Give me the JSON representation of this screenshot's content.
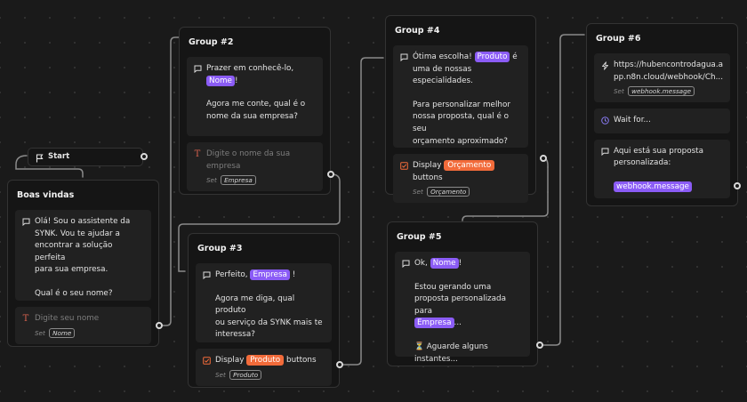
{
  "start": {
    "label": "Start"
  },
  "groups": {
    "boas_vindas": {
      "title": "Boas vindas",
      "message": {
        "l1": "Olá! Sou o assistente da",
        "l2": "SYNK. Vou te ajudar a",
        "l3": "encontrar a solução perfeita",
        "l4": "para sua empresa.",
        "l5": "Qual é o seu nome?"
      },
      "input": {
        "placeholder": "Digite seu nome",
        "set_label": "Set",
        "variable": "Nome"
      }
    },
    "group2": {
      "title": "Group #2",
      "message": {
        "l1_before": "Prazer em conhecê-lo,",
        "var": "Nome",
        "l2_after": "!",
        "l3": "Agora me conte, qual é o",
        "l4": "nome da sua empresa?"
      },
      "input": {
        "placeholder_l1": "Digite o nome da sua",
        "placeholder_l2": "empresa",
        "set_label": "Set",
        "variable": "Empresa"
      }
    },
    "group3": {
      "title": "Group #3",
      "message": {
        "before": "Perfeito,",
        "var": "Empresa",
        "after": "!",
        "l2": "Agora me diga, qual produto",
        "l3": "ou serviço da SYNK mais te",
        "l4": "interessa?"
      },
      "buttons": {
        "before": "Display",
        "var": "Produto",
        "after": "buttons",
        "set_label": "Set",
        "variable": "Produto"
      }
    },
    "group4": {
      "title": "Group #4",
      "message": {
        "before": "Ótima escolha!",
        "var": "Produto",
        "after": "é",
        "l2": "uma de nossas",
        "l3": "especialidades.",
        "l4": "Para personalizar melhor",
        "l5": "nossa proposta, qual é o seu",
        "l6": "orçamento aproximado?"
      },
      "buttons": {
        "before": "Display",
        "var": "Orçamento",
        "after": "buttons",
        "set_label": "Set",
        "variable": "Orçamento"
      }
    },
    "group5": {
      "title": "Group #5",
      "message": {
        "before": "Ok,",
        "var1": "Nome",
        "after": "!",
        "l2": "Estou gerando uma",
        "l3": "proposta personalizada para",
        "var2": "Empresa",
        "ellipsis": "...",
        "l4": "⏳ Aguarde alguns",
        "l5": "instantes..."
      }
    },
    "group6": {
      "title": "Group #6",
      "webhook": {
        "url_l1": "https://hubencontrodagua.a",
        "url_l2": "pp.n8n.cloud/webhook/Ch...",
        "set_label": "Set",
        "variable": "webhook.message"
      },
      "wait": {
        "label": "Wait for..."
      },
      "message": {
        "l1": "Aqui está sua proposta",
        "l2": "personalizada:",
        "var": "webhook.message"
      }
    }
  },
  "colors": {
    "background": "#1a1a1a",
    "card": "#151515",
    "block": "#212121",
    "purple": "#8b5cf6",
    "orange": "#f26b3a",
    "edge": "#8a8a8a",
    "wait_icon": "#8b7cf6",
    "input_icon": "#d9634f"
  }
}
